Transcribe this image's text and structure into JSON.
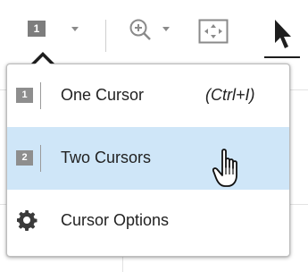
{
  "toolbar": {
    "cursor_mode_badge": "1"
  },
  "menu": {
    "items": [
      {
        "badge": "1",
        "label": "One Cursor",
        "shortcut": "(Ctrl+I)"
      },
      {
        "badge": "2",
        "label": "Two Cursors",
        "shortcut": ""
      },
      {
        "icon": "gear-icon",
        "label": "Cursor Options",
        "shortcut": ""
      }
    ],
    "highlight_color": "#cfe6f8"
  }
}
